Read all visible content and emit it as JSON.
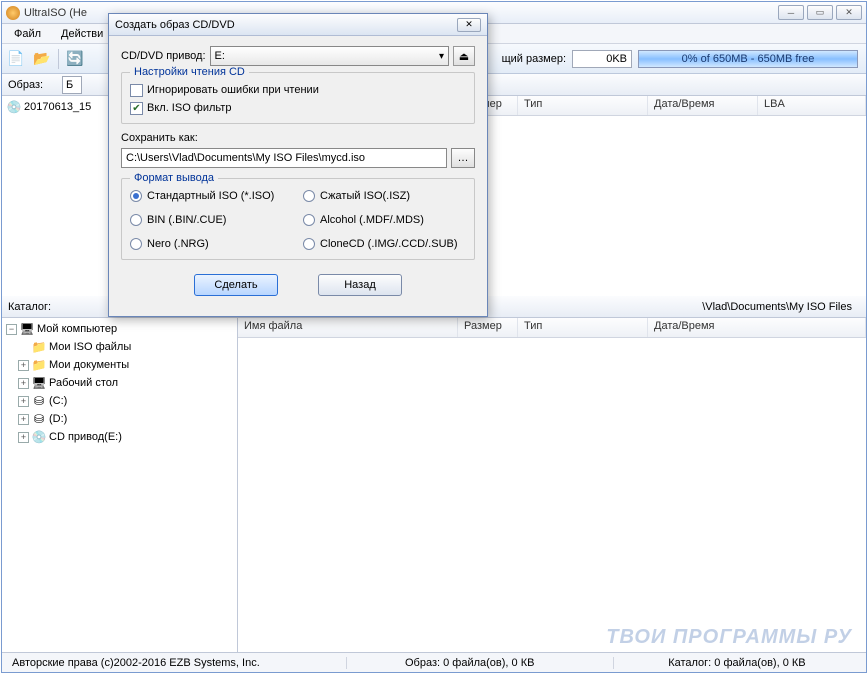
{
  "window": {
    "title": "UltraISO (Не"
  },
  "menu": {
    "file": "Файл",
    "actions": "Действи"
  },
  "toolbar": {
    "total_label": "щий размер:",
    "total_value": "0KB",
    "progress_text": "0% of 650MB - 650MB free"
  },
  "image_bar": {
    "label": "Образ:",
    "field_prefix": "Б"
  },
  "upper_tree": {
    "root": "20170613_15"
  },
  "columns": {
    "filename": "Имя файла",
    "size": "Размер",
    "type": "Тип",
    "datetime": "Дата/Время",
    "lba": "LBA"
  },
  "catalog_bar": {
    "label": "Каталог:",
    "path": "\\Vlad\\Documents\\My ISO Files"
  },
  "lower_tree": {
    "root": "Мой компьютер",
    "items": [
      {
        "label": "Мои ISO файлы",
        "icon": "📁",
        "exp": ""
      },
      {
        "label": "Мои документы",
        "icon": "📁",
        "exp": "+"
      },
      {
        "label": "Рабочий стол",
        "icon": "🖥",
        "exp": "+"
      },
      {
        "label": "(C:)",
        "icon": "⛁",
        "exp": "+"
      },
      {
        "label": "(D:)",
        "icon": "⛁",
        "exp": "+"
      },
      {
        "label": "CD привод(E:)",
        "icon": "💿",
        "exp": "+"
      }
    ]
  },
  "status": {
    "copyright": "Авторские права (c)2002-2016 EZB Systems, Inc.",
    "image": "Образ: 0 файла(ов), 0 КВ",
    "catalog": "Каталог: 0 файла(ов), 0 КВ"
  },
  "dialog": {
    "title": "Создать образ CD/DVD",
    "drive_label": "CD/DVD привод:",
    "drive_value": "E:",
    "group_read": "Настройки чтения CD",
    "opt_ignore": "Игнорировать ошибки при чтении",
    "opt_iso": "Вкл. ISO фильтр",
    "save_as": "Сохранить как:",
    "save_path": "C:\\Users\\Vlad\\Documents\\My ISO Files\\mycd.iso",
    "group_fmt": "Формат вывода",
    "fmt": {
      "iso": "Стандартный ISO (*.ISO)",
      "isz": "Сжатый ISO(.ISZ)",
      "bin": "BIN (.BIN/.CUE)",
      "mdf": "Alcohol (.MDF/.MDS)",
      "nrg": "Nero (.NRG)",
      "ccd": "CloneCD (.IMG/.CCD/.SUB)"
    },
    "btn_make": "Сделать",
    "btn_back": "Назад"
  },
  "watermark": "ТВОИ ПРОГРАММЫ РУ"
}
